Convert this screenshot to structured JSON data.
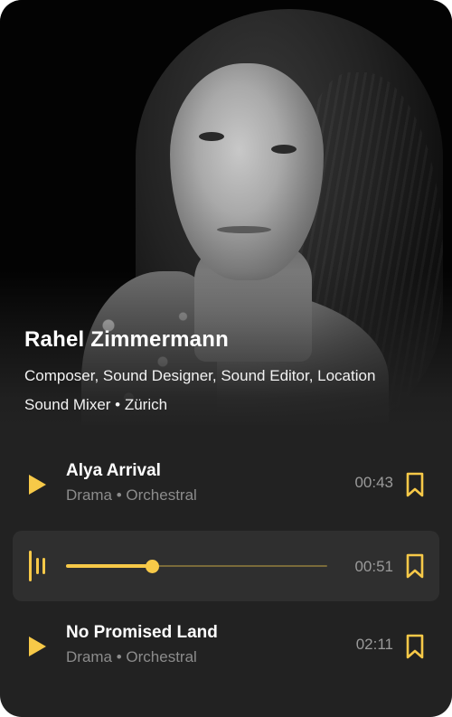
{
  "profile": {
    "name": "Rahel Zimmermann",
    "roles": "Composer, Sound Designer, Sound Editor, Location Sound Mixer • Zürich"
  },
  "tracks": [
    {
      "title": "Alya Arrival",
      "meta": "Drama • Orchestral",
      "duration": "00:43",
      "state": "paused"
    },
    {
      "title": "",
      "meta": "",
      "duration": "00:51",
      "state": "playing",
      "progress": 0.33
    },
    {
      "title": "No Promised Land",
      "meta": "Drama • Orchestral",
      "duration": "02:11",
      "state": "paused"
    }
  ],
  "colors": {
    "accent": "#f7c948",
    "card_bg": "#222222",
    "active_row_bg": "#2f2f2f",
    "title": "#ffffff",
    "muted": "#8c8c8c"
  },
  "icons": {
    "play": "play-icon",
    "pause": "pause-icon",
    "bookmark": "bookmark-icon"
  }
}
